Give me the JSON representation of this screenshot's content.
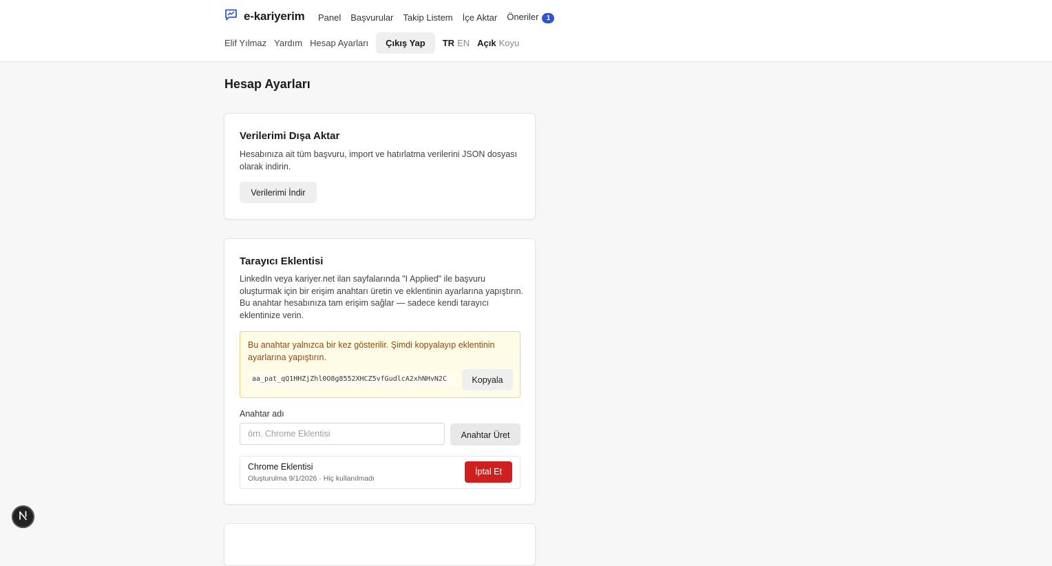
{
  "header": {
    "brand": "e-kariyerim",
    "nav": [
      {
        "label": "Panel"
      },
      {
        "label": "Başvurular"
      },
      {
        "label": "Takip Listem"
      },
      {
        "label": "İçe Aktar"
      },
      {
        "label": "Öneriler",
        "badge": "1"
      }
    ],
    "user_name": "Elif Yılmaz",
    "help": "Yardım",
    "account_settings": "Hesap Ayarları",
    "logout": "Çıkış Yap",
    "lang_active": "TR",
    "lang_inactive": "EN",
    "theme_active": "Açık",
    "theme_inactive": "Koyu"
  },
  "page": {
    "title": "Hesap Ayarları"
  },
  "export_card": {
    "title": "Verilerimi Dışa Aktar",
    "description": "Hesabınıza ait tüm başvuru, import ve hatırlatma verilerini JSON dosyası olarak indirin.",
    "button": "Verilerimi İndir"
  },
  "extension_card": {
    "title": "Tarayıcı Eklentisi",
    "description": "LinkedIn veya kariyer.net ilan sayfalarında \"I Applied\" ile başvuru oluşturmak için bir erişim anahtarı üretin ve eklentinin ayarlarına yapıştırın. Bu anahtar hesabınıza tam erişim sağlar — sadece kendi tarayıcı eklentinize verin.",
    "warning": "Bu anahtar yalnızca bir kez gösterilir. Şimdi kopyalayıp eklentinin ayarlarına yapıştırın.",
    "token": "aa_pat_qQ1HHZjZhl0O8g8552XHCZ5vfGudlcA2xhNHvN2C",
    "copy_button": "Kopyala",
    "key_name_label": "Anahtar adı",
    "key_name_placeholder": "örn. Chrome Eklentisi",
    "generate_button": "Anahtar Üret",
    "keys": [
      {
        "name": "Chrome Eklentisi",
        "meta": "Oluşturulma 9/1/2026 · Hiç kullanılmadı",
        "revoke_button": "İptal Et"
      }
    ]
  },
  "colors": {
    "accent": "#2f55d4",
    "danger": "#cf1f1f",
    "warning_bg": "#fefbe6",
    "warning_border": "#f2d47b"
  }
}
